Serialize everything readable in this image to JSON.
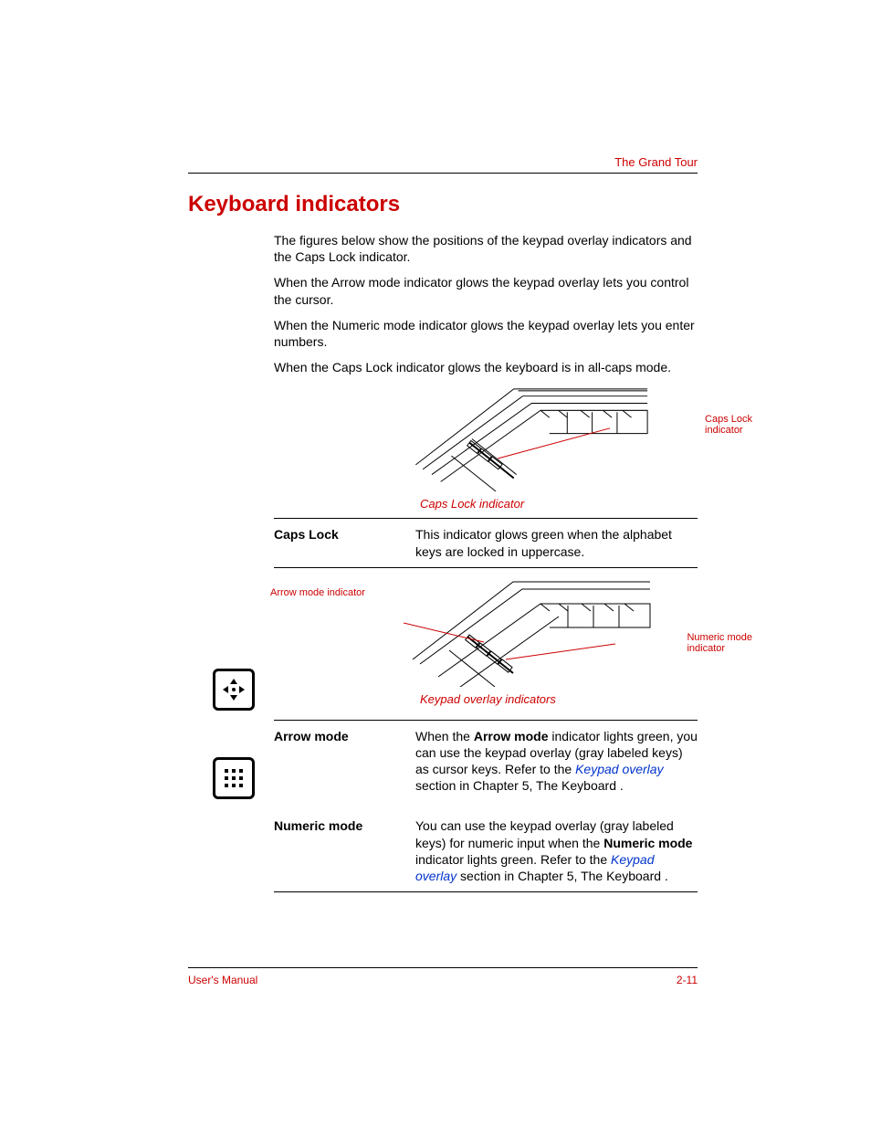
{
  "header": {
    "chapter": "The Grand Tour"
  },
  "title": "Keyboard indicators",
  "intro": {
    "p1": "The figures below show the positions of the keypad overlay indicators and the Caps Lock indicator.",
    "p2": "When the Arrow mode indicator glows the keypad overlay lets you control the cursor.",
    "p3": "When the Numeric mode indicator glows the keypad overlay lets you enter numbers.",
    "p4": "When the Caps Lock indicator glows the keyboard is in all-caps mode."
  },
  "figures": {
    "fig1": {
      "callout1_l1": "Caps Lock",
      "callout1_l2": "indicator",
      "caption": "Caps Lock indicator"
    },
    "fig2": {
      "left_label": "Arrow mode indicator",
      "callout2_l1": "Numeric mode",
      "callout2_l2": "indicator",
      "caption": "Keypad overlay indicators"
    }
  },
  "rows": {
    "caps": {
      "label": "Caps Lock",
      "desc": "This indicator glows green when the alphabet keys are locked in uppercase."
    },
    "arrow": {
      "label": "Arrow mode",
      "pre": "When the ",
      "bold": "Arrow mode",
      "mid": " indicator lights green, you can use the keypad overlay (gray labeled keys) as cursor keys. Refer to the ",
      "link": "Keypad overlay",
      "post": " section in Chapter 5, The Keyboard ."
    },
    "numeric": {
      "label": "Numeric mode",
      "pre": "You can use the keypad overlay (gray labeled keys) for numeric input when the ",
      "bold": "Numeric mode",
      "mid": " indicator lights green. Refer to the ",
      "link": "Keypad overlay",
      "post": " section in Chapter 5, The Keyboard ."
    }
  },
  "footer": {
    "left": "User's Manual",
    "right": "2-11"
  }
}
